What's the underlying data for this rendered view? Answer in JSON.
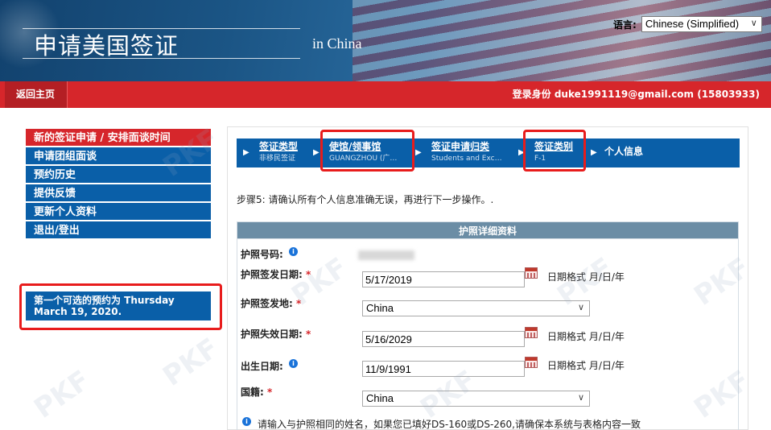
{
  "banner": {
    "title": "申请美国签证",
    "subtitle": "in China",
    "language_label": "语言:",
    "language_value": "Chinese (Simplified)"
  },
  "nav": {
    "home": "返回主页",
    "login": "登录身份  duke1991119@gmail.com (15803933)"
  },
  "sidebar": {
    "items": [
      {
        "label": "新的签证申请 / 安排面谈时间"
      },
      {
        "label": "申请团组面谈"
      },
      {
        "label": "预约历史"
      },
      {
        "label": "提供反馈"
      },
      {
        "label": "更新个人资料"
      },
      {
        "label": "退出/登出"
      }
    ],
    "appointment_line1": "第一个可选的预约为 Thursday",
    "appointment_line2": "March 19, 2020."
  },
  "steps": [
    {
      "label": "签证类型",
      "value": "非移民签证"
    },
    {
      "label": "使馆/领事馆",
      "value": "GUANGZHOU (广…"
    },
    {
      "label": "签证申请归类",
      "value": "Students and Exc…"
    },
    {
      "label": "签证类别",
      "value": "F-1"
    },
    {
      "label": "个人信息",
      "value": ""
    }
  ],
  "step_instruction": "步骤5: 请确认所有个人信息准确无误，再进行下一步操作。.",
  "section_title": "护照详细资料",
  "form": {
    "passport_number_label": "护照号码:",
    "issue_date_label": "护照签发日期:",
    "issue_date_value": "5/17/2019",
    "issue_place_label": "护照签发地:",
    "issue_place_value": "China",
    "expiry_date_label": "护照失效日期:",
    "expiry_date_value": "5/16/2029",
    "birth_date_label": "出生日期:",
    "birth_date_value": "11/9/1991",
    "nationality_label": "国籍:",
    "nationality_value": "China",
    "date_format": "日期格式 月/日/年",
    "required_mark": "*",
    "info_glyph": "i",
    "note": "请输入与护照相同的姓名，如果您已填好DS-160或DS-260,请确保本系统与表格内容一致"
  },
  "watermark": "PKF",
  "colors": {
    "nav_red": "#d6262b",
    "sidebar_blue": "#0a5fa8",
    "section_head": "#6b8da5",
    "highlight_red": "#e81c1c"
  }
}
